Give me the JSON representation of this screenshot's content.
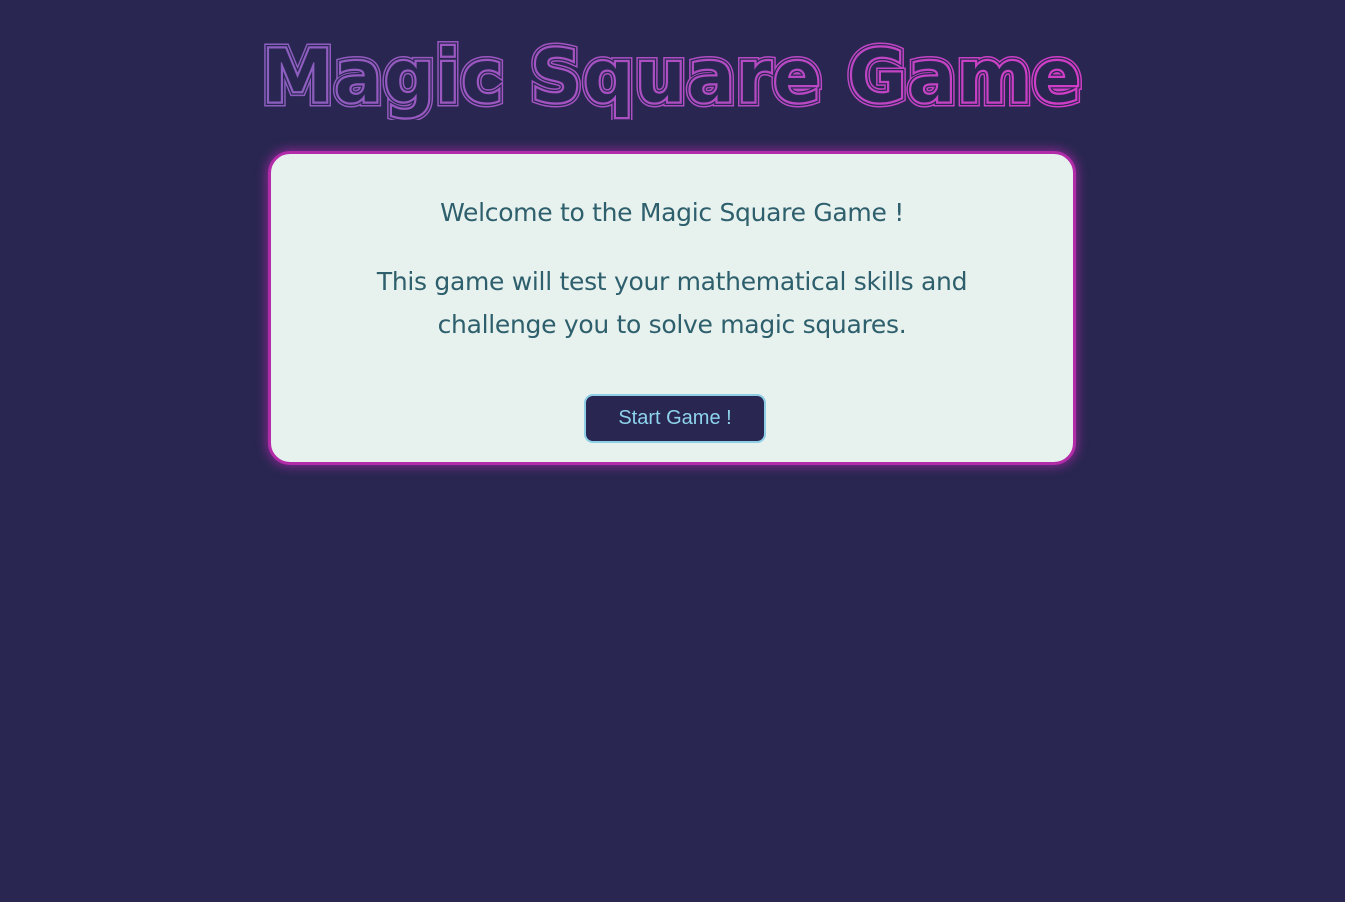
{
  "header": {
    "title": "Magic Square Game"
  },
  "card": {
    "welcome": "Welcome to the Magic Square Game !",
    "description": "This game will test your mathematical skills and challenge you to solve magic squares.",
    "start_button_label": "Start Game !"
  },
  "colors": {
    "background": "#292751",
    "card_background": "#e7f1ee",
    "card_border": "#b22ba8",
    "title_gradient_start": "#8a5fbf",
    "title_gradient_end": "#d23cc6",
    "text": "#2e5f6c",
    "button_text": "#8ed3ec",
    "button_border": "#8ecfe6"
  }
}
